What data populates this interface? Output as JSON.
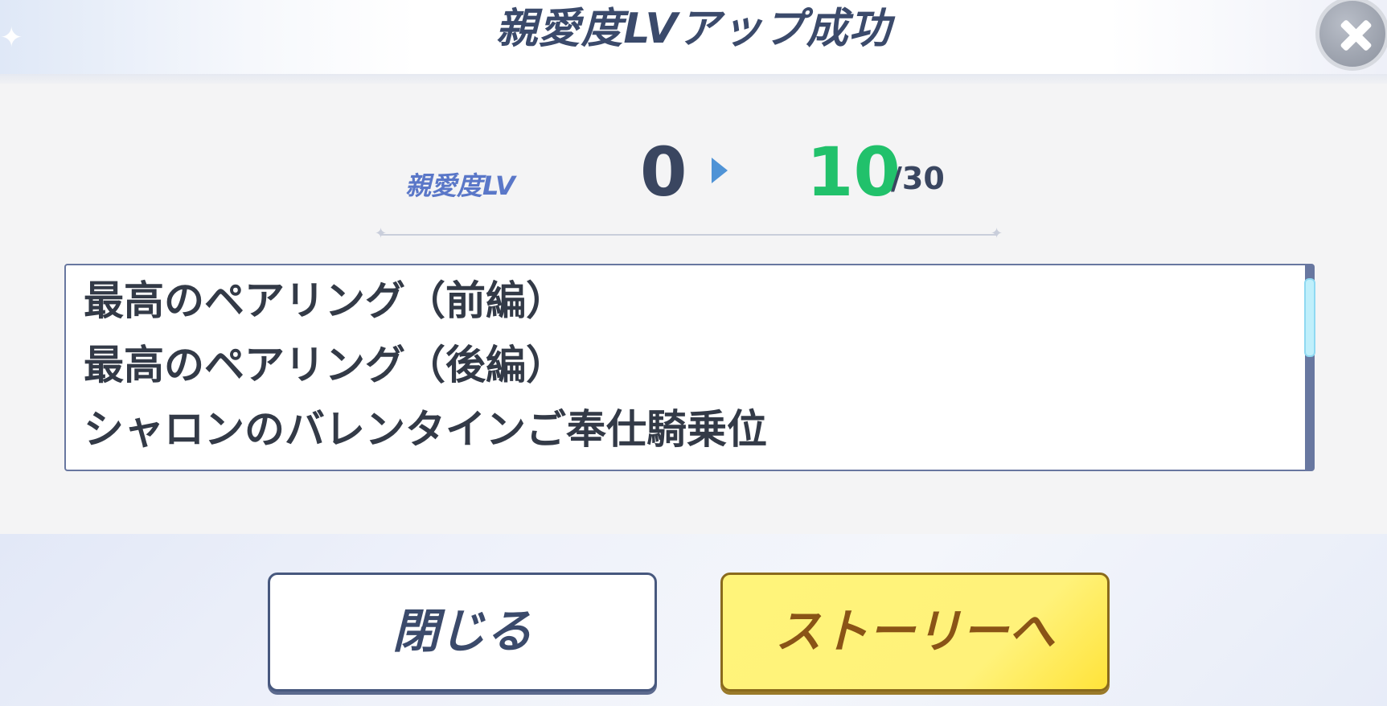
{
  "header": {
    "title": "親愛度LVアップ成功"
  },
  "level": {
    "label": "親愛度LV",
    "old_value": "0",
    "new_value": "10",
    "max_value": "/30"
  },
  "stories": [
    "最高のペアリング（前編）",
    "最高のペアリング（後編）",
    "シャロンのバレンタインご奉仕騎乗位"
  ],
  "buttons": {
    "close_label": "閉じる",
    "story_label": "ストーリーへ"
  },
  "colors": {
    "new_level": "#21c16b",
    "story_button": "#fff27a"
  },
  "icons": {
    "close": "close-icon",
    "arrow": "arrow-right-icon"
  }
}
